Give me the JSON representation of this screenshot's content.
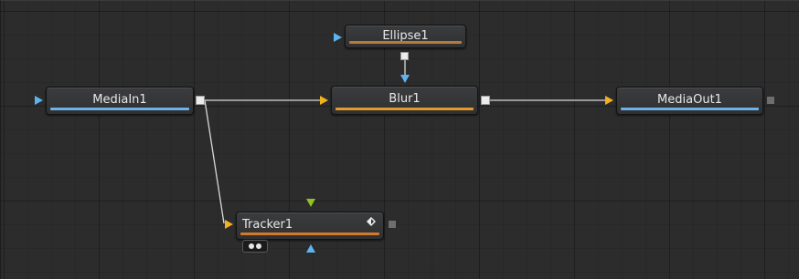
{
  "colors": {
    "canvas_bg": "#2c2c2d",
    "blue_accent": "#5db3f0",
    "orange_accent": "#e8952c",
    "yellow_input": "#f2b21f",
    "green_input": "#8fc31f",
    "wire": "#d9d9d9"
  },
  "nodes": {
    "ellipse": {
      "label": "Ellipse1",
      "bar_color": "#b87936"
    },
    "media_in": {
      "label": "MediaIn1",
      "bar_color": "#6db3ea"
    },
    "blur": {
      "label": "Blur1",
      "bar_color": "#e59a2d"
    },
    "media_out": {
      "label": "MediaOut1",
      "bar_color": "#6db3ea"
    },
    "tracker": {
      "label": "Tracker1",
      "bar_color": "#d27a2b"
    }
  },
  "icons": {
    "input": "triangle-input-icon",
    "output": "square-output-icon",
    "keyframe": "diamond-keyframe-icon",
    "tracker_badge": "two-dots-badge-icon"
  }
}
